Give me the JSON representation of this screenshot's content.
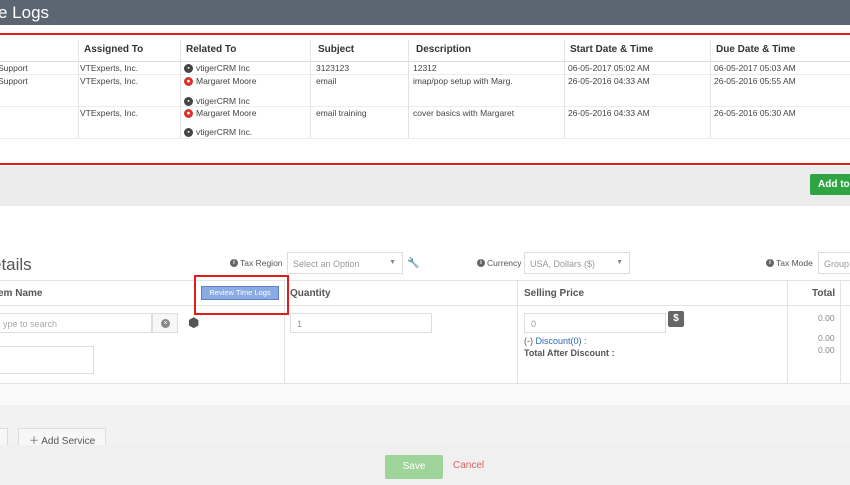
{
  "header": {
    "title": "e Logs"
  },
  "time_logs": {
    "columns": [
      "Assigned To",
      "Related To",
      "Subject",
      "Description",
      "Start Date & Time",
      "Due Date & Time"
    ],
    "rows": [
      {
        "owner": "Support",
        "assigned_to": "VTExperts, Inc.",
        "related": [
          "vtigerCRM Inc"
        ],
        "subject": "3123123",
        "description": "12312",
        "start": "06-05-2017 05:02 AM",
        "due": "06-05-2017 05:03 AM"
      },
      {
        "owner": "Support",
        "assigned_to": "VTExperts, Inc.",
        "related": [
          "Margaret Moore",
          "vtigerCRM Inc"
        ],
        "subject": "email",
        "description": "imap/pop setup with Marg.",
        "start": "26-05-2016 04:33 AM",
        "due": "26-05-2016 05:55 AM"
      },
      {
        "owner": "",
        "assigned_to": "VTExperts, Inc.",
        "related": [
          "Margaret Moore",
          "vtigerCRM Inc."
        ],
        "subject": "email training",
        "description": "cover basics with Margaret",
        "start": "26-05-2016 04:33 AM",
        "due": "26-05-2016 05:30 AM"
      }
    ],
    "add_button": "Add to"
  },
  "item_details": {
    "title": "etails",
    "tax_region_label": "Tax Region",
    "tax_region_placeholder": "Select an Option",
    "currency_label": "Currency",
    "currency_value": "USA, Dollars ($)",
    "tax_mode_label": "Tax Mode",
    "tax_mode_value": "Group",
    "columns": {
      "item_name": "em Name",
      "quantity": "Quantity",
      "selling_price": "Selling Price",
      "total": "Total"
    },
    "review_button": "Review Time Logs",
    "search_placeholder": "ype to search",
    "quantity_value": "1",
    "price_value": "0",
    "discount_label": "(-)",
    "discount_link": "Discount(0) :",
    "total_after_discount": "Total After Discount :",
    "totals": [
      "0.00",
      "0.00",
      "0.00"
    ]
  },
  "footer": {
    "add_service": "Add Service",
    "save": "Save",
    "cancel": "Cancel"
  },
  "colors": {
    "title_bar": "#5b6672",
    "highlight": "#e21b1b",
    "add_button": "#2ea542",
    "save_button": "#9ed39a"
  }
}
